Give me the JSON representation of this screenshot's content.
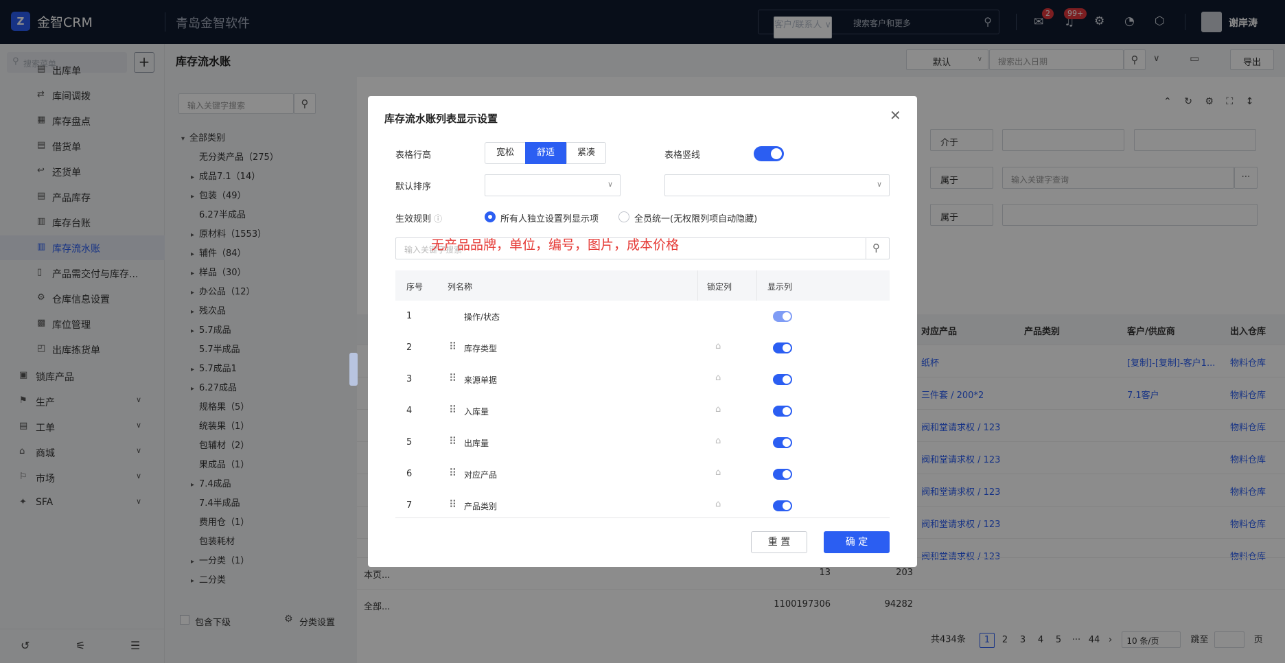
{
  "topbar": {
    "logo_char": "Z",
    "brand": "金智CRM",
    "company": "青岛金智软件",
    "search_scope": "客户/联系人",
    "search_placeholder": "搜索客户和更多",
    "badge_msg": "2",
    "badge_notice": "99+",
    "user": "谢岸涛"
  },
  "sidebar": {
    "search_placeholder": "搜索菜单",
    "items": [
      {
        "label": "出库单",
        "icon": "doc-icon",
        "sub": true
      },
      {
        "label": "库间调拨",
        "icon": "transfer-icon",
        "sub": true
      },
      {
        "label": "库存盘点",
        "icon": "list-icon",
        "sub": true
      },
      {
        "label": "借货单",
        "icon": "doc-icon",
        "sub": true
      },
      {
        "label": "还货单",
        "icon": "return-icon",
        "sub": true
      },
      {
        "label": "产品库存",
        "icon": "doc-icon",
        "sub": true
      },
      {
        "label": "库存台账",
        "icon": "ledger-icon",
        "sub": true
      },
      {
        "label": "库存流水账",
        "icon": "ledger-icon",
        "sub": true,
        "active": true
      },
      {
        "label": "产品需交付与库存...",
        "icon": "book-icon",
        "sub": true
      },
      {
        "label": "仓库信息设置",
        "icon": "gear-icon",
        "sub": true
      },
      {
        "label": "库位管理",
        "icon": "grid-icon",
        "sub": true
      },
      {
        "label": "出库拣货单",
        "icon": "pick-icon",
        "sub": true
      },
      {
        "label": "锁库产品",
        "icon": "lock-icon",
        "sub": false
      },
      {
        "label": "生产",
        "icon": "factory-icon",
        "sub": false,
        "arrow": true
      },
      {
        "label": "工单",
        "icon": "doc-icon",
        "sub": false,
        "arrow": true
      },
      {
        "label": "商城",
        "icon": "shop-icon",
        "sub": false,
        "arrow": true
      },
      {
        "label": "市场",
        "icon": "flag-icon",
        "sub": false,
        "arrow": true
      },
      {
        "label": "SFA",
        "icon": "sfa-icon",
        "sub": false,
        "arrow": true
      }
    ]
  },
  "main": {
    "title": "库存流水账",
    "view_select": "默认",
    "date_placeholder": "搜索出入日期",
    "export_label": "导出",
    "cat_search_placeholder": "输入关键字搜索",
    "include_sub": "包含下级",
    "cat_settings": "分类设置"
  },
  "categories": [
    {
      "label": "全部类别",
      "caret": "▾",
      "lvl": 0
    },
    {
      "label": "无分类产品（275）",
      "lvl": 1
    },
    {
      "label": "成品7.1（14）",
      "caret": "▸",
      "lvl": 1
    },
    {
      "label": "包装（49）",
      "caret": "▸",
      "lvl": 1
    },
    {
      "label": "6.27半成品",
      "lvl": 1
    },
    {
      "label": "原材料（1553）",
      "caret": "▸",
      "lvl": 1
    },
    {
      "label": "辅件（84）",
      "caret": "▸",
      "lvl": 1
    },
    {
      "label": "样品（30）",
      "caret": "▸",
      "lvl": 1
    },
    {
      "label": "办公品（12）",
      "caret": "▸",
      "lvl": 1
    },
    {
      "label": "残次品",
      "caret": "▸",
      "lvl": 1
    },
    {
      "label": "5.7成品",
      "caret": "▸",
      "lvl": 1
    },
    {
      "label": "5.7半成品",
      "lvl": 1
    },
    {
      "label": "5.7成品1",
      "caret": "▸",
      "lvl": 1
    },
    {
      "label": "6.27成品",
      "caret": "▸",
      "lvl": 1
    },
    {
      "label": "规格果（5）",
      "lvl": 1
    },
    {
      "label": "统装果（1）",
      "lvl": 1
    },
    {
      "label": "包辅材（2）",
      "lvl": 1
    },
    {
      "label": "果成品（1）",
      "lvl": 1
    },
    {
      "label": "7.4成品",
      "caret": "▸",
      "lvl": 1
    },
    {
      "label": "7.4半成品",
      "lvl": 1
    },
    {
      "label": "费用仓（1）",
      "lvl": 1
    },
    {
      "label": "包装耗材",
      "lvl": 1
    },
    {
      "label": "一分类（1）",
      "caret": "▸",
      "lvl": 1
    },
    {
      "label": "二分类",
      "caret": "▸",
      "lvl": 1
    }
  ],
  "filters": {
    "op1": "介于",
    "op2": "属于",
    "op2_placeholder": "输入关键字查询",
    "op3": "属于"
  },
  "table": {
    "headers": [
      "对应产品",
      "产品类别",
      "客户/供应商",
      "出入仓库"
    ],
    "rows": [
      [
        "纸杯",
        "",
        "[复制]-[复制]-客户1...",
        "物料仓库"
      ],
      [
        "三件套 / 200*2",
        "",
        "7.1客户",
        "物料仓库"
      ],
      [
        "阀和堂请求权 / 123",
        "",
        "",
        "物料仓库"
      ],
      [
        "阀和堂请求权 / 123",
        "",
        "",
        "物料仓库"
      ],
      [
        "阀和堂请求权 / 123",
        "",
        "",
        "物料仓库"
      ],
      [
        "阀和堂请求权 / 123",
        "",
        "",
        "物料仓库"
      ],
      [
        "阀和堂请求权 / 123",
        "",
        "",
        "物料仓库"
      ]
    ],
    "page_total_label": "本页...",
    "page_total_a": "13",
    "page_total_b": "203",
    "all_total_label": "全部...",
    "all_total_a": "1100197306",
    "all_total_b": "94282"
  },
  "pagination": {
    "total": "共434条",
    "pages": [
      "1",
      "2",
      "3",
      "4",
      "5",
      "···",
      "44"
    ],
    "page_size": "10 条/页",
    "goto": "跳至",
    "page_unit": "页"
  },
  "modal": {
    "title": "库存流水账列表显示设置",
    "row_height_label": "表格行高",
    "row_height_opts": [
      "宽松",
      "舒适",
      "紧凑"
    ],
    "row_height_selected": "舒适",
    "vline_label": "表格竖线",
    "default_sort_label": "默认排序",
    "rule_label": "生效规则",
    "rule_opt1": "所有人独立设置列显示项",
    "rule_opt2": "全员统一(无权限列项自动隐藏)",
    "search_placeholder": "输入关键字搜索",
    "annotation": "无产品品牌，单位，编号，图片，成本价格",
    "col_seq": "序号",
    "col_name": "列名称",
    "col_lock": "锁定列",
    "col_show": "显示列",
    "rows": [
      {
        "n": "1",
        "name": "操作/状态"
      },
      {
        "n": "2",
        "name": "库存类型"
      },
      {
        "n": "3",
        "name": "来源单据"
      },
      {
        "n": "4",
        "name": "入库量"
      },
      {
        "n": "5",
        "name": "出库量"
      },
      {
        "n": "6",
        "name": "对应产品"
      },
      {
        "n": "7",
        "name": "产品类别"
      }
    ],
    "reset_label": "重 置",
    "ok_label": "确 定"
  },
  "colors": {
    "primary": "#2b5ef2",
    "topbar": "#0f1a2e",
    "annotation": "#e53935"
  }
}
